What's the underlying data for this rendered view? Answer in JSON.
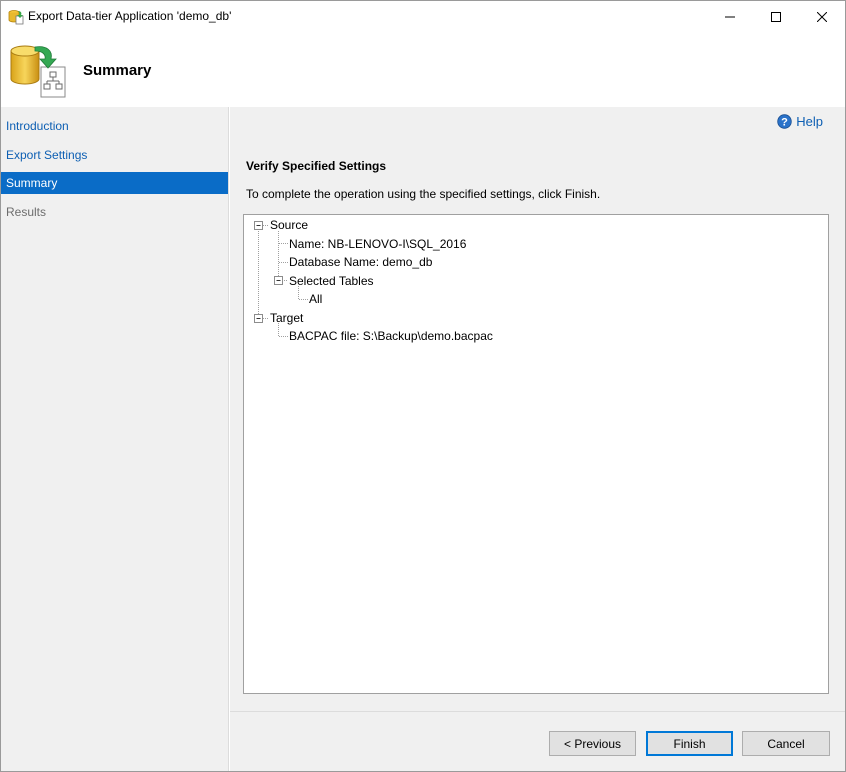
{
  "window": {
    "title": "Export Data-tier Application 'demo_db'"
  },
  "header": {
    "title": "Summary"
  },
  "sidebar": {
    "items": [
      {
        "label": "Introduction",
        "state": "link"
      },
      {
        "label": "Export Settings",
        "state": "link"
      },
      {
        "label": "Summary",
        "state": "selected"
      },
      {
        "label": "Results",
        "state": "disabled"
      }
    ]
  },
  "main": {
    "help_label": "Help",
    "section_title": "Verify Specified Settings",
    "instruction": "To complete the operation using the specified settings, click Finish.",
    "tree": {
      "source_label": "Source",
      "name": "Name: NB-LENOVO-I\\SQL_2016",
      "database_name": "Database Name: demo_db",
      "selected_tables": "Selected Tables",
      "all": "All",
      "target_label": "Target",
      "bacpac_file": "BACPAC file: S:\\Backup\\demo.bacpac"
    }
  },
  "footer": {
    "previous_label": "< Previous",
    "finish_label": "Finish",
    "cancel_label": "Cancel"
  },
  "colors": {
    "accent": "#0a6cc7",
    "link": "#0d5fb3",
    "panel": "#f0f0f0"
  }
}
